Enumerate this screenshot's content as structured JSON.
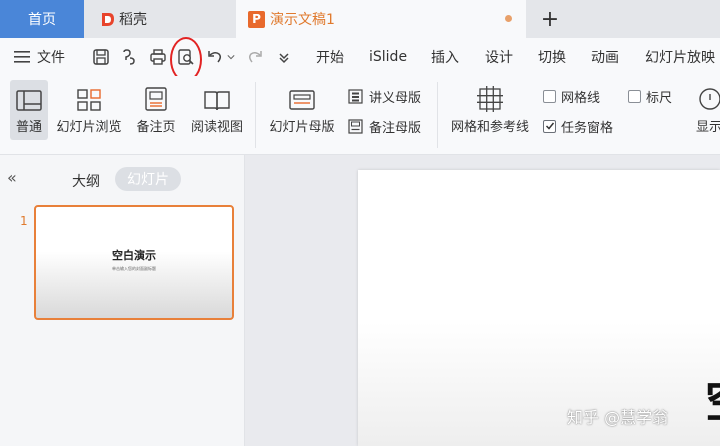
{
  "tabs": {
    "home": "首页",
    "daoke": "稻壳",
    "document": "演示文稿1",
    "new_tab": "+"
  },
  "menu": {
    "file": "文件",
    "items": [
      "开始",
      "iSlide",
      "插入",
      "设计",
      "切换",
      "动画",
      "幻灯片放映"
    ]
  },
  "ribbon": {
    "normal": "普通",
    "slide_sorter": "幻灯片浏览",
    "notes_page": "备注页",
    "reading_view": "阅读视图",
    "slide_master": "幻灯片母版",
    "handout_master": "讲义母版",
    "notes_master": "备注母版",
    "grid_guides": "网格和参考线",
    "gridlines": "网格线",
    "ruler": "标尺",
    "task_pane": "任务窗格",
    "display": "显示"
  },
  "checkboxes": {
    "gridlines": false,
    "ruler": false,
    "task_pane": true
  },
  "panel": {
    "outline": "大纲",
    "slides": "幻灯片",
    "collapse_glyph": "«"
  },
  "slides": [
    {
      "number": "1",
      "title": "空白演示",
      "subtitle": "单击输入您的封面副标题"
    }
  ],
  "canvas": {
    "partial_char": "空"
  },
  "watermark": "知乎 @慧学翁",
  "colors": {
    "accent": "#e8692c",
    "home_tab": "#4a86d8",
    "highlight_circle": "#e22323"
  }
}
